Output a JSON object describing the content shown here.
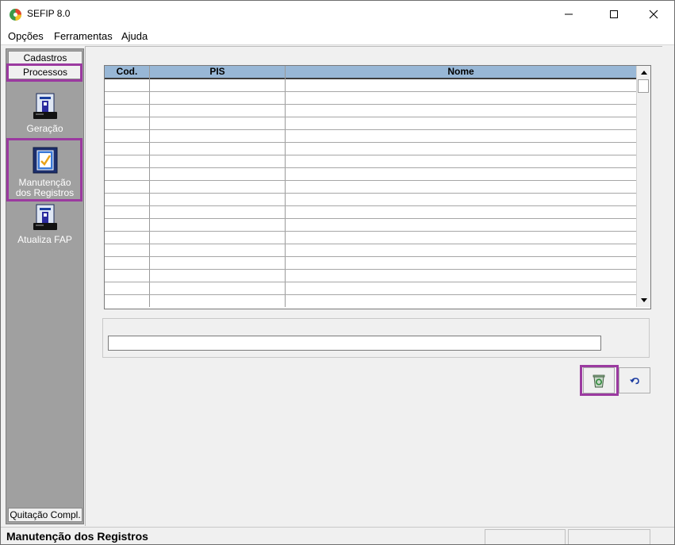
{
  "window": {
    "title": "SEFIP 8.0",
    "controls": [
      "minimize-icon",
      "maximize-icon",
      "close-icon"
    ]
  },
  "menu": [
    "Opções",
    "Ferramentas",
    "Ajuda"
  ],
  "sidebar": {
    "tabs": {
      "cadastros": "Cadastros",
      "processos": "Processos",
      "quitacao": "Quitação Compl."
    },
    "buttons": [
      {
        "label": "Geração",
        "icon": "document-disk-icon"
      },
      {
        "label_line1": "Manutenção",
        "label_line2": "dos Registros",
        "icon": "checklist-icon"
      },
      {
        "label": "Atualiza FAP",
        "icon": "document-disk-icon"
      }
    ]
  },
  "table": {
    "columns": [
      "Cod.",
      "PIS",
      "Nome"
    ],
    "rows": 17
  },
  "actions": {
    "delete_icon": "recycle-bin-icon",
    "undo_icon": "undo-icon"
  },
  "status": {
    "text": "Manutenção dos Registros"
  },
  "colors": {
    "highlight": "#9b3aa0",
    "sidebar": "#a0a0a0",
    "grid_header": "#98b7d6"
  }
}
